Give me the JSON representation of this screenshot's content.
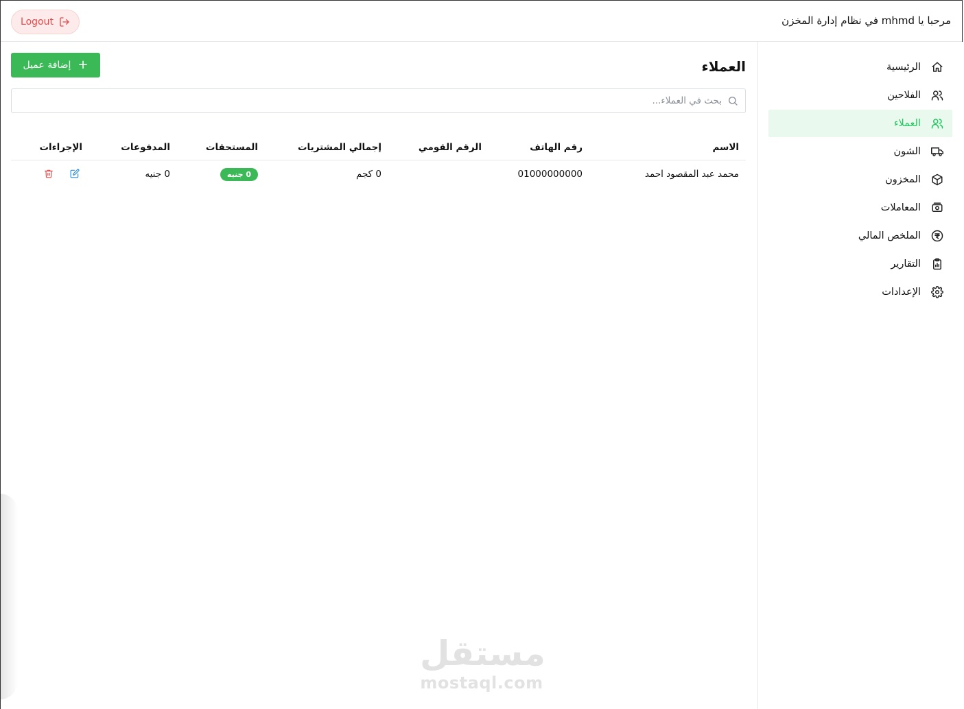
{
  "header": {
    "welcome": "مرحبا يا mhmd في نظام إدارة المخزن",
    "logout_label": "Logout"
  },
  "sidebar": {
    "items": [
      {
        "label": "الرئيسية",
        "icon": "home-icon",
        "active": false
      },
      {
        "label": "الفلاحين",
        "icon": "users-icon",
        "active": false
      },
      {
        "label": "العملاء",
        "icon": "users-icon",
        "active": true
      },
      {
        "label": "الشون",
        "icon": "truck-icon",
        "active": false
      },
      {
        "label": "المخزون",
        "icon": "box-icon",
        "active": false
      },
      {
        "label": "المعاملات",
        "icon": "cash-icon",
        "active": false
      },
      {
        "label": "الملخص المالي",
        "icon": "currency-circle-icon",
        "active": false
      },
      {
        "label": "التقارير",
        "icon": "clipboard-icon",
        "active": false
      },
      {
        "label": "الإعدادات",
        "icon": "gear-icon",
        "active": false
      }
    ],
    "active_color": "#22c55e"
  },
  "main": {
    "title": "العملاء",
    "add_button_label": "إضافة عميل",
    "search_placeholder": "بحث في العملاء...",
    "table": {
      "headers": [
        "الاسم",
        "رقم الهاتف",
        "الرقم القومي",
        "إجمالي المشتريات",
        "المستحقات",
        "المدفوعات",
        "الإجراءات"
      ],
      "rows": [
        {
          "name": "محمد عبد المقصود احمد",
          "phone": "01000000000",
          "national_id": "",
          "total_purchases": "0 كجم",
          "dues": "0 جنيه",
          "payments": "0 جنيه"
        }
      ]
    }
  },
  "watermark": {
    "ar": "مستقل",
    "en": "mostaql.com"
  },
  "colors": {
    "accent": "#3cb957",
    "danger": "#e14b4b",
    "edit": "#2b8fd6"
  }
}
